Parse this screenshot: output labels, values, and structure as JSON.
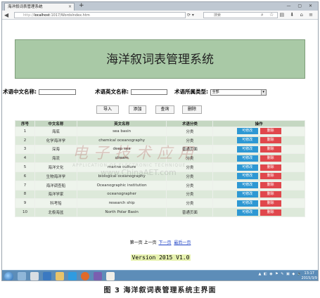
{
  "browser": {
    "tab_title": "海洋叙词表管理系统",
    "tab_close": "×",
    "new_tab": "+",
    "window_controls": "— ▢ ✕",
    "back_glyph": "◀",
    "url_scheme": "http://",
    "url_host": "localhost",
    "url_path": ":1017/WordsIndex.htm",
    "reload_glyph": "⟳ ▾",
    "search_placeholder": "搜索",
    "nav_icons": "⌕ ☆ ▤ ⬇ ⌂ ≡"
  },
  "app": {
    "title": "海洋叙词表管理系统",
    "form": {
      "cn_label": "术语中文名称:",
      "en_label": "术语英文名称:",
      "type_label": "术语所属类型:",
      "type_value": "全部"
    },
    "buttons": {
      "import": "导入",
      "add": "添加",
      "query": "查询",
      "delete": "删除"
    },
    "table": {
      "headers": [
        "序号",
        "中文名称",
        "英文名称",
        "术语分类",
        "操作"
      ],
      "rows": [
        {
          "no": "1",
          "cn": "海底",
          "en": "sea basin",
          "type": "分类"
        },
        {
          "no": "2",
          "cn": "化学海洋学",
          "en": "chemical oceanography",
          "type": "分类"
        },
        {
          "no": "3",
          "cn": "深海",
          "en": "deep sea",
          "type": "普通页面"
        },
        {
          "no": "4",
          "cn": "海流",
          "en": "stream",
          "type": "分类"
        },
        {
          "no": "5",
          "cn": "海洋文化",
          "en": "marine culture",
          "type": "分类"
        },
        {
          "no": "6",
          "cn": "生物海洋学",
          "en": "biological oceanography",
          "type": "分类"
        },
        {
          "no": "7",
          "cn": "海洋调查船",
          "en": "Oceanographic institution",
          "type": "分类"
        },
        {
          "no": "8",
          "cn": "海洋学家",
          "en": "oceanographer",
          "type": "分类"
        },
        {
          "no": "9",
          "cn": "科考船",
          "en": "research ship",
          "type": "分类"
        },
        {
          "no": "10",
          "cn": "北极海盆",
          "en": "North Polar Basin",
          "type": "普通页面"
        }
      ],
      "edit_label": "可修改",
      "delete_label": "删除"
    },
    "pager": {
      "first": "第一页",
      "prev": "上一页",
      "next": "下一页",
      "last": "最后一页"
    },
    "version": "Version 2015 V1.0"
  },
  "watermark": {
    "main": "电子技术应用",
    "sub": "APPLICATION OF ELECTRONIC TECHNIQUE",
    "url": "www.ChinaAET.com"
  },
  "taskbar": {
    "tray": "▲ ◧ ◉ ⚑ ✎ ▣ ◆ 🔈",
    "time": "13:17",
    "date": "2015/3/9"
  },
  "caption": "图 3   海洋叙词表管理系统主界面",
  "colors": {
    "banner": "#a9c9a6",
    "header_row": "#c5d7c2",
    "edit_button": "#2e98d3",
    "delete_button": "#e0474c",
    "taskbar": "#5d8db8"
  }
}
